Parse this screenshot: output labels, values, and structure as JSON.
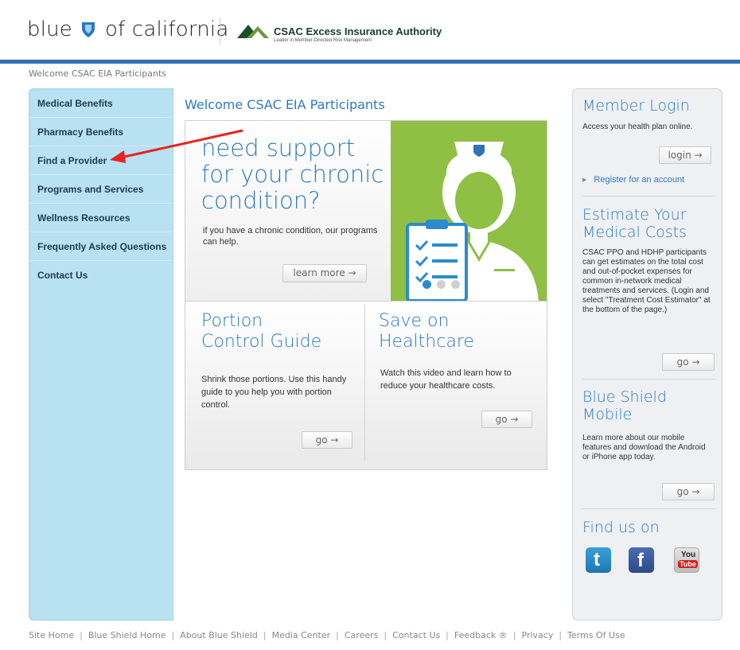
{
  "header": {
    "brand_left": "blue",
    "brand_right": "of california",
    "partner_title": "CSAC Excess Insurance Authority",
    "partner_tagline": "Leader in Member-Directed Risk Management"
  },
  "breadcrumb": "Welcome CSAC EIA Participants",
  "leftnav": {
    "items": [
      {
        "label": "Medical Benefits"
      },
      {
        "label": "Pharmacy Benefits"
      },
      {
        "label": "Find a Provider"
      },
      {
        "label": "Programs and Services"
      },
      {
        "label": "Wellness Resources"
      },
      {
        "label": "Frequently Asked Questions"
      },
      {
        "label": "Contact Us"
      }
    ]
  },
  "main": {
    "title": "Welcome CSAC EIA Participants",
    "hero": {
      "heading_line1": "need support",
      "heading_line2": "for your chronic",
      "heading_line3": "condition?",
      "body": "if you have a chronic condition, our programs can help.",
      "button": "learn more →",
      "slide_count": 3,
      "active_slide": 1
    },
    "promos": [
      {
        "heading_line1": "Portion",
        "heading_line2": "Control Guide",
        "body": "Shrink those portions. Use this handy guide to you help you with portion control.",
        "button": "go →"
      },
      {
        "heading_line1": "Save on",
        "heading_line2": "Healthcare",
        "body": "Watch this video and learn how to reduce your healthcare costs.",
        "button": "go →"
      }
    ]
  },
  "sidebar": {
    "login": {
      "title": "Member Login",
      "body": "Access your health plan online.",
      "button": "login →",
      "register_link": "Register for an account"
    },
    "estimate": {
      "title_line1": "Estimate Your",
      "title_line2": "Medical Costs",
      "body": "CSAC PPO and HDHP participants can get estimates on the total cost and out-of-pocket expenses for common in-network medical treatments and services. (Login and select \"Treatment Cost Estimator\" at the bottom of the page.)",
      "button": "go →"
    },
    "mobile": {
      "title_line1": "Blue Shield",
      "title_line2": "Mobile",
      "body": "Learn more about our mobile features and download the Android or iPhone app today.",
      "button": "go →"
    },
    "social": {
      "title": "Find us on",
      "twitter_glyph": "t",
      "facebook_glyph": "f",
      "youtube_top": "You",
      "youtube_bottom": "Tube"
    }
  },
  "footer": {
    "links": [
      {
        "label": "Site Home"
      },
      {
        "label": "Blue Shield Home"
      },
      {
        "label": "About Blue Shield"
      },
      {
        "label": "Media Center"
      },
      {
        "label": "Careers"
      },
      {
        "label": "Contact Us"
      },
      {
        "label": "Feedback ®"
      },
      {
        "label": "Privacy"
      },
      {
        "label": "Terms Of Use"
      }
    ]
  },
  "colors": {
    "brand_blue": "#2c7bc2",
    "topbar_blue": "#2e73b8",
    "nav_bg": "#b8e1f2",
    "hero_green": "#8fc043",
    "annotation_red": "#e8221d"
  },
  "icons": [
    "blue-shield-icon",
    "csac-triangle-icon",
    "nurse-illustration",
    "clipboard-icon",
    "twitter-icon",
    "facebook-icon",
    "youtube-icon",
    "arrow-right-icon",
    "bullet-triangle-icon"
  ]
}
